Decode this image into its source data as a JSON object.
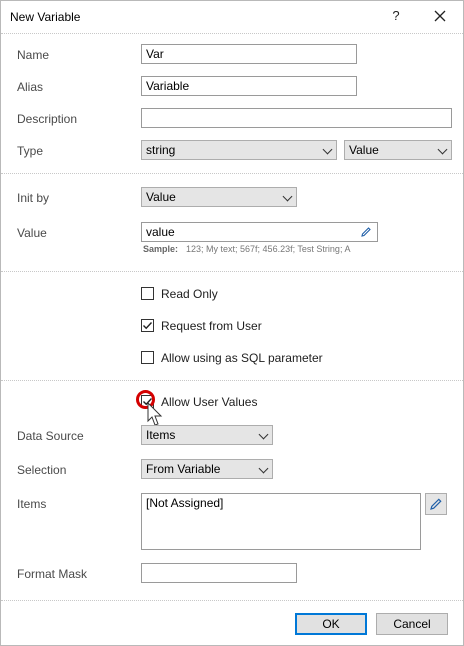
{
  "dialog": {
    "title": "New Variable",
    "help_label": "?",
    "close_label": "✕"
  },
  "fields": {
    "name_label": "Name",
    "name_value": "Var",
    "alias_label": "Alias",
    "alias_value": "Variable",
    "description_label": "Description",
    "description_value": "",
    "type_label": "Type",
    "type_value": "string",
    "type_kind_value": "Value",
    "init_by_label": "Init by",
    "init_by_value": "Value",
    "value_label": "Value",
    "value_value": "value",
    "sample_label": "Sample:",
    "sample_text": "123; My text; 567f; 456.23f; Test String; A"
  },
  "options": {
    "read_only": {
      "label": "Read Only",
      "checked": false
    },
    "request_from_user": {
      "label": "Request from User",
      "checked": true
    },
    "sql_parameter": {
      "label": "Allow using as SQL parameter",
      "checked": false
    },
    "allow_user_values": {
      "label": "Allow User Values",
      "checked": true
    }
  },
  "user_values": {
    "data_source_label": "Data Source",
    "data_source_value": "Items",
    "selection_label": "Selection",
    "selection_value": "From Variable",
    "items_label": "Items",
    "items_value": "[Not Assigned]",
    "format_mask_label": "Format Mask",
    "format_mask_value": ""
  },
  "buttons": {
    "ok": "OK",
    "cancel": "Cancel"
  },
  "colors": {
    "accent": "#0078d7",
    "highlight_ring": "#d40000",
    "select_bg": "#e5e5e5"
  },
  "icons": [
    "help-icon",
    "close-icon",
    "chevron-down-icon",
    "pencil-icon",
    "checkmark-icon",
    "mouse-cursor-icon"
  ]
}
